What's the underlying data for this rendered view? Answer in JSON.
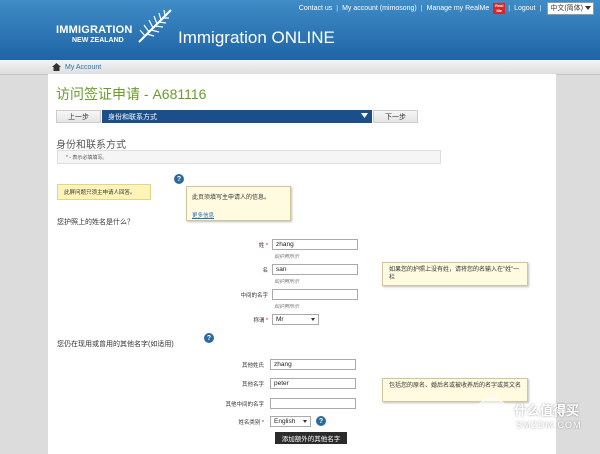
{
  "topnav": {
    "contact": "Contact us",
    "account": "My account (mimosong)",
    "realme_manage": "Manage my RealMe",
    "realme_logo": "Real Me",
    "logout": "Logout",
    "separator": "|",
    "lang": "中文(简体)"
  },
  "header": {
    "brand_line1": "IMMIGRATION",
    "brand_line2": "NEW ZEALAND",
    "app_title": "Immigration ONLINE"
  },
  "breadcrumb": {
    "item": "My Account"
  },
  "form": {
    "title": "访问签证申请 - A681116",
    "prev": "上一步",
    "current_step": "身份和联系方式",
    "next": "下一步",
    "section": "身份和联系方式",
    "required_note": "* - 表示必填填写。",
    "principal_note": "此屏问题只须主申请人回答。",
    "tip1": "此页须填写主申请人的信息。",
    "tip1_more": "更多信息",
    "q1": "您护照上的姓名是什么？",
    "surname_label": "姓",
    "surname_value": "zhang",
    "surname_hint": "如护照所示",
    "given_label": "名",
    "given_value": "san",
    "given_hint": "如护照所示",
    "middle_label": "中间的名字",
    "middle_value": "",
    "middle_hint": "如护照所示",
    "title_label": "称谓",
    "title_value": "Mr",
    "tip2": "如果您的护照上没有姓，请将您的名输入在\"姓\"一栏",
    "q2": "您仍在现用或曾用的其他名字(如适用)",
    "other_surname_label": "其他姓氏",
    "other_surname_value": "zhang",
    "other_given_label": "其他名字",
    "other_given_value": "peter",
    "other_middle_label": "其他中间的名字",
    "other_middle_value": "",
    "name_type_label": "姓名类别",
    "name_type_value": "English",
    "tip3": "包括您的原名、婚后名或被收养后的名字或英文名",
    "add_button": "添加额外的其他名字"
  },
  "watermark": {
    "line1": "什么值得买",
    "line2": "SMZDM.COM",
    "badge": "值"
  },
  "icons": {
    "help": "?",
    "star": "*"
  },
  "colors": {
    "header": "#1f64a6",
    "title_green": "#6b9b2d",
    "step_bar": "#1b4f8a"
  }
}
